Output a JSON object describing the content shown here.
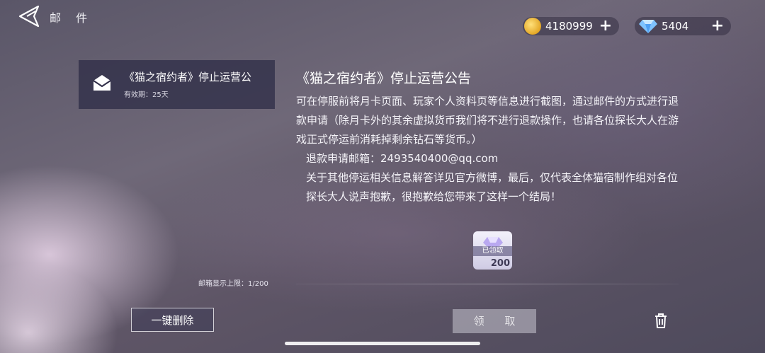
{
  "header": {
    "title": "邮 件"
  },
  "currencies": {
    "coins": {
      "value": "4180999",
      "plus": "+"
    },
    "diamonds": {
      "value": "5404",
      "plus": "+"
    }
  },
  "mail_list": {
    "items": [
      {
        "subject": "《猫之宿约者》停止运营公",
        "expiry": "有效期：25天"
      }
    ],
    "limit_label": "邮箱显示上限：1/200"
  },
  "mail": {
    "title": "《猫之宿约者》停止运营公告",
    "paragraphs": [
      "可在停服前将月卡页面、玩家个人资料页等信息进行截图，通过邮件的方式进行退款申请（除月卡外的其余虚拟货币我们将不进行退款操作，也请各位探长大人在游戏正式停运前消耗掉剩余钻石等货币。）",
      "退款申请邮箱：2493540400@qq.com",
      "关于其他停运相关信息解答详见官方微博，最后，仅代表全体猫宿制作组对各位探长大人说声抱歉，很抱歉给您带来了这样一个结局！"
    ],
    "attachment": {
      "status": "已领取",
      "count": "200"
    }
  },
  "buttons": {
    "delete_all": "一键删除",
    "claim": "领 取"
  },
  "colors": {
    "panel": "#302e48",
    "accent": "#ffffff"
  }
}
